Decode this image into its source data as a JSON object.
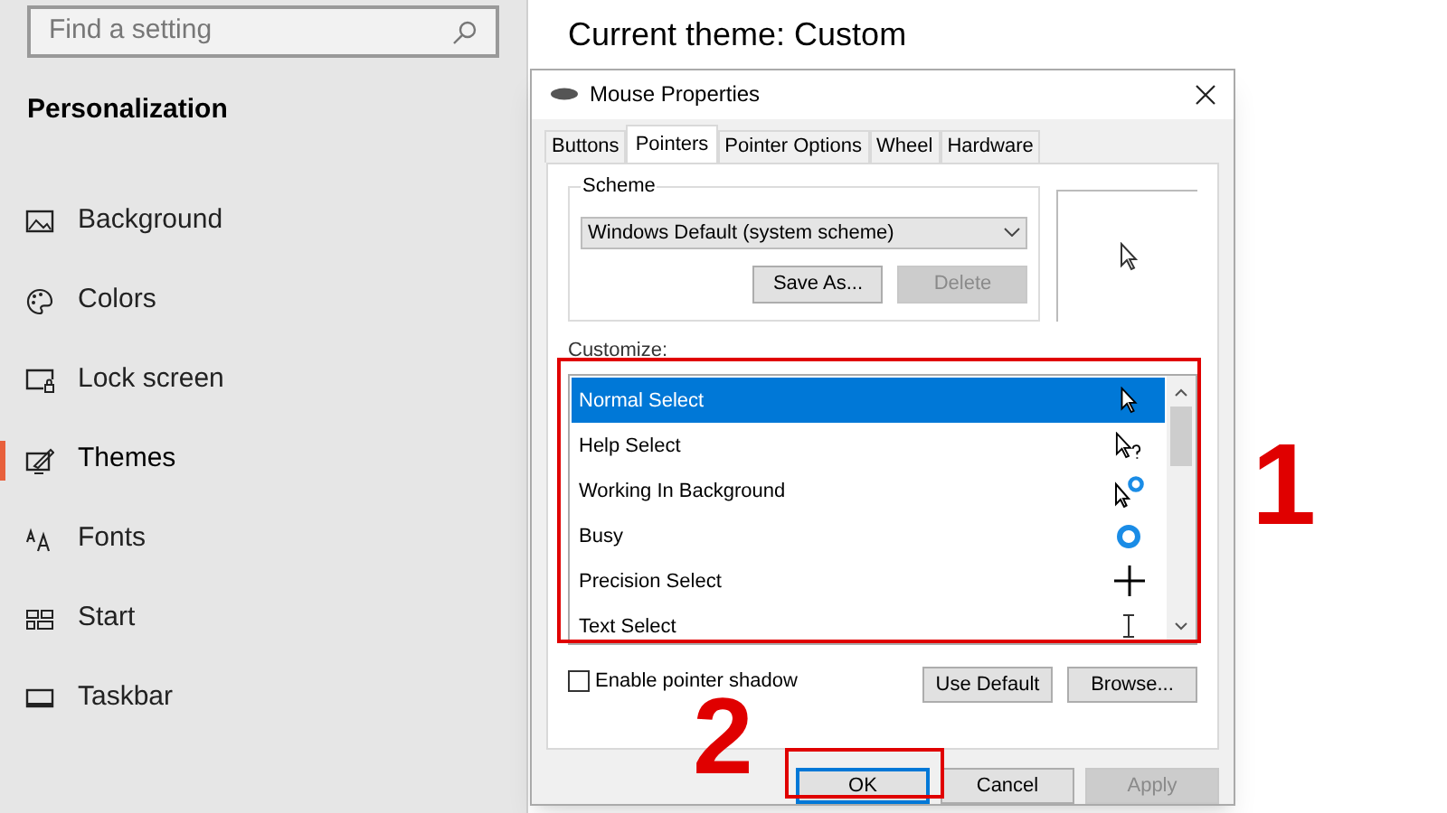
{
  "settings": {
    "search": {
      "placeholder": "Find a setting"
    },
    "heading": "Personalization",
    "nav": [
      {
        "label": "Background",
        "selected": false
      },
      {
        "label": "Colors",
        "selected": false
      },
      {
        "label": "Lock screen",
        "selected": false
      },
      {
        "label": "Themes",
        "selected": true
      },
      {
        "label": "Fonts",
        "selected": false
      },
      {
        "label": "Start",
        "selected": false
      },
      {
        "label": "Taskbar",
        "selected": false
      }
    ],
    "page_title": "Current theme: Custom"
  },
  "dialog": {
    "title": "Mouse Properties",
    "tabs": [
      {
        "label": "Buttons",
        "selected": false
      },
      {
        "label": "Pointers",
        "selected": true
      },
      {
        "label": "Pointer Options",
        "selected": false
      },
      {
        "label": "Wheel",
        "selected": false
      },
      {
        "label": "Hardware",
        "selected": false
      }
    ],
    "scheme": {
      "label": "Scheme",
      "value": "Windows Default (system scheme)",
      "buttons": [
        {
          "label": "Save As...",
          "disabled": false
        },
        {
          "label": "Delete",
          "disabled": true
        }
      ]
    },
    "customize": {
      "label": "Customize:",
      "items": [
        {
          "label": "Normal Select",
          "selected": true
        },
        {
          "label": "Help Select",
          "selected": false
        },
        {
          "label": "Working In Background",
          "selected": false
        },
        {
          "label": "Busy",
          "selected": false
        },
        {
          "label": "Precision Select",
          "selected": false
        },
        {
          "label": "Text Select",
          "selected": false
        }
      ]
    },
    "shadow": {
      "label": "Enable pointer shadow",
      "checked": false
    },
    "list_buttons": [
      {
        "label": "Use Default",
        "disabled": false
      },
      {
        "label": "Browse...",
        "disabled": false
      }
    ],
    "footer_buttons": [
      {
        "label": "OK",
        "disabled": false,
        "default": true
      },
      {
        "label": "Cancel",
        "disabled": false,
        "default": false
      },
      {
        "label": "Apply",
        "disabled": true,
        "default": false
      }
    ]
  },
  "annotations": [
    {
      "label": "1"
    },
    {
      "label": "2"
    }
  ]
}
